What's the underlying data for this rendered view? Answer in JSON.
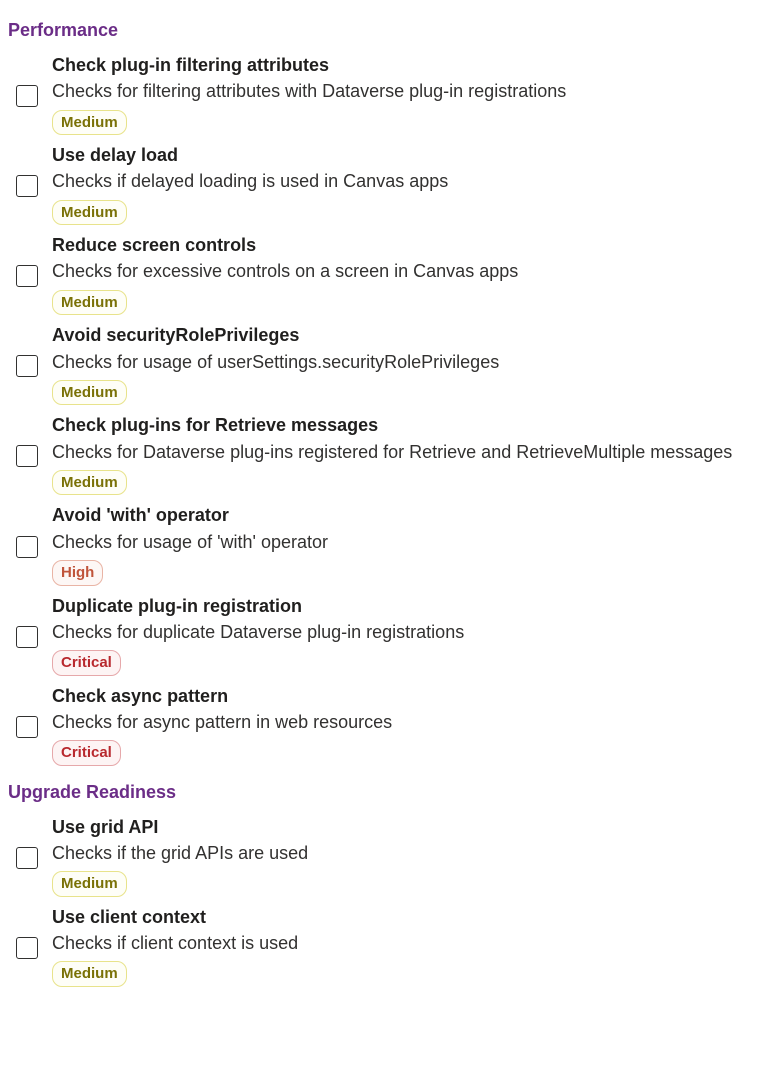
{
  "sections": [
    {
      "title": "Performance",
      "rules": [
        {
          "title": "Check plug-in filtering attributes",
          "description": "Checks for filtering attributes with Dataverse plug-in registrations",
          "severity": "Medium"
        },
        {
          "title": "Use delay load",
          "description": "Checks if delayed loading is used in Canvas apps",
          "severity": "Medium"
        },
        {
          "title": "Reduce screen controls",
          "description": "Checks for excessive controls on a screen in Canvas apps",
          "severity": "Medium"
        },
        {
          "title": "Avoid securityRolePrivileges",
          "description": "Checks for usage of userSettings.securityRolePrivileges",
          "severity": "Medium"
        },
        {
          "title": "Check plug-ins for Retrieve messages",
          "description": "Checks for Dataverse plug-ins registered for Retrieve and RetrieveMultiple messages",
          "severity": "Medium"
        },
        {
          "title": "Avoid 'with' operator",
          "description": "Checks for usage of 'with' operator",
          "severity": "High"
        },
        {
          "title": "Duplicate plug-in registration",
          "description": "Checks for duplicate Dataverse plug-in registrations",
          "severity": "Critical"
        },
        {
          "title": "Check async pattern",
          "description": "Checks for async pattern in web resources",
          "severity": "Critical"
        }
      ]
    },
    {
      "title": "Upgrade Readiness",
      "rules": [
        {
          "title": "Use grid API",
          "description": "Checks if the grid APIs are used",
          "severity": "Medium"
        },
        {
          "title": "Use client context",
          "description": "Checks if client context is used",
          "severity": "Medium"
        }
      ]
    }
  ]
}
